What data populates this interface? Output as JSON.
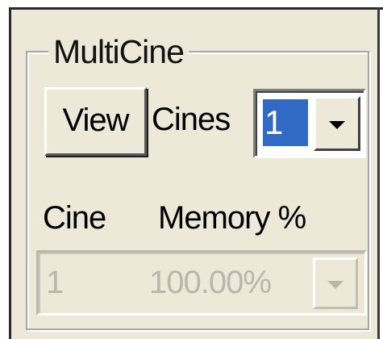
{
  "groupbox": {
    "title": "MultiCine"
  },
  "view_button": {
    "label": "View"
  },
  "cines": {
    "label": "Cines",
    "selected": "1",
    "icon": "chevron-down-icon"
  },
  "columns": {
    "cine_label": "Cine",
    "memory_label": "Memory %"
  },
  "memory_select": {
    "cine_value": "1",
    "memory_value": "100.00%",
    "disabled": true,
    "icon": "chevron-down-icon"
  },
  "colors": {
    "face": "#ece9d8",
    "selection": "#316ac5",
    "disabled_text": "#b9b7ab"
  }
}
